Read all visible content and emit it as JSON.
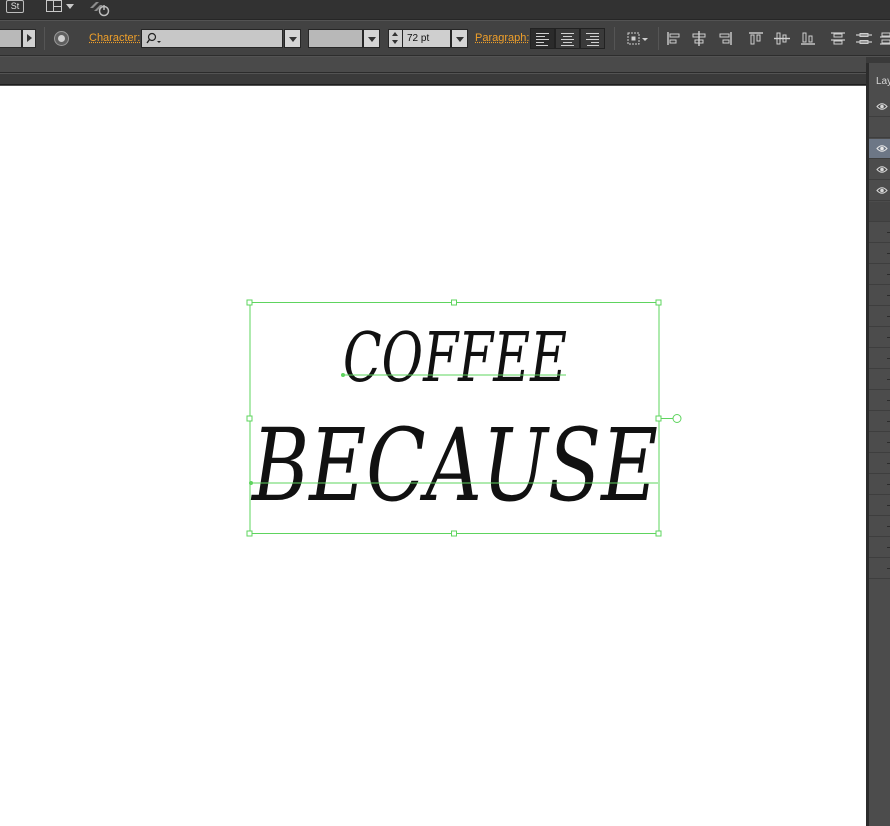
{
  "app_bar": {
    "stock_badge": "St",
    "icons": [
      "workspace-switcher-icon",
      "sync-settings-icon"
    ]
  },
  "control_bar": {
    "character_label": "Character:",
    "font_family_value": "",
    "font_style_value": "",
    "font_size_value": "72 pt",
    "paragraph_label": "Paragraph:",
    "alignment": [
      "align-left",
      "align-center",
      "align-right"
    ],
    "active_alignment": "align-left"
  },
  "layers_panel": {
    "tab_label": "Layers"
  },
  "artwork": {
    "line1": "COFFEE",
    "line2": "BECAUSE",
    "selection_color": "#5ed45e"
  }
}
